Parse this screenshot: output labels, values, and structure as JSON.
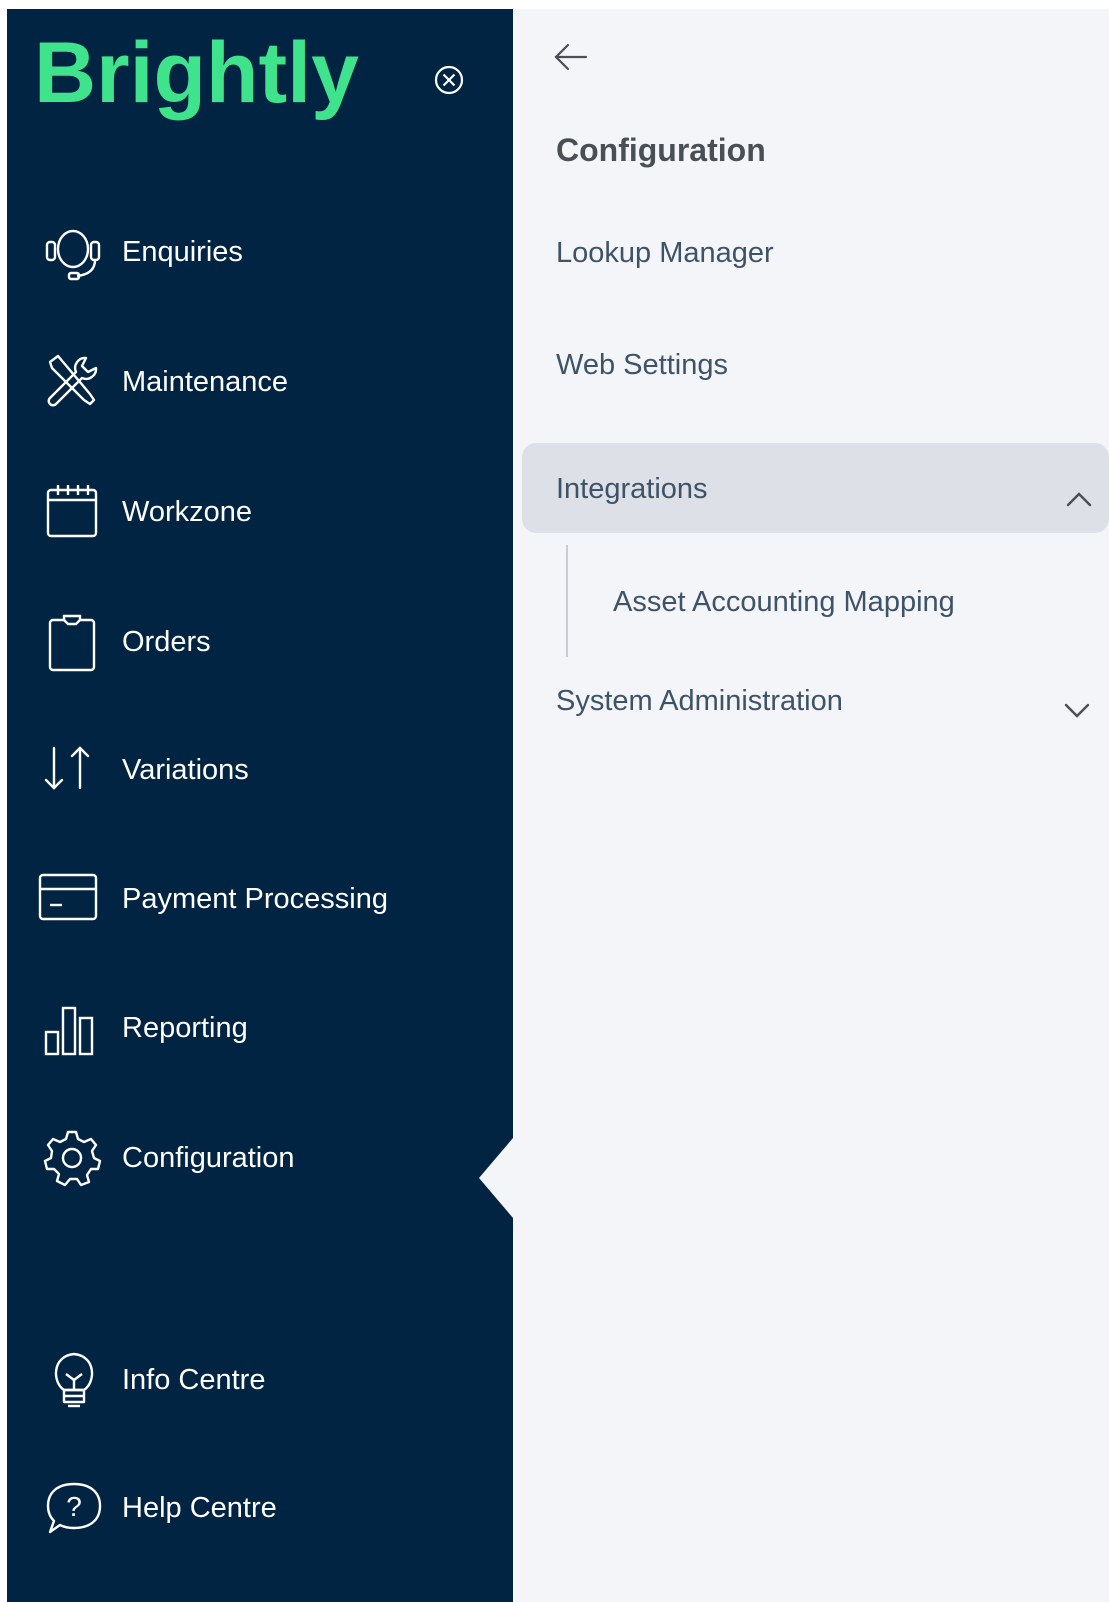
{
  "brand": {
    "logo_text": "Brightly",
    "accent_color": "#3ee38c",
    "sidebar_color": "#022443",
    "panel_color": "#f4f5f8"
  },
  "sidebar": {
    "close_icon": "close-circle-icon",
    "items": [
      {
        "label": "Enquiries",
        "icon": "headset-icon"
      },
      {
        "label": "Maintenance",
        "icon": "tools-icon"
      },
      {
        "label": "Workzone",
        "icon": "calendar-icon"
      },
      {
        "label": "Orders",
        "icon": "clipboard-icon"
      },
      {
        "label": "Variations",
        "icon": "sort-arrows-icon"
      },
      {
        "label": "Payment Processing",
        "icon": "card-icon"
      },
      {
        "label": "Reporting",
        "icon": "bar-chart-icon"
      },
      {
        "label": "Configuration",
        "icon": "gear-icon",
        "active": true
      },
      {
        "label": "Info Centre",
        "icon": "lightbulb-icon"
      },
      {
        "label": "Help Centre",
        "icon": "question-bubble-icon"
      }
    ]
  },
  "panel": {
    "back_icon": "arrow-left-icon",
    "title": "Configuration",
    "items": [
      {
        "label": "Lookup Manager"
      },
      {
        "label": "Web Settings"
      },
      {
        "label": "Integrations",
        "expanded": true,
        "children": [
          {
            "label": "Asset Accounting Mapping"
          }
        ]
      },
      {
        "label": "System Administration",
        "expanded": false
      }
    ]
  }
}
